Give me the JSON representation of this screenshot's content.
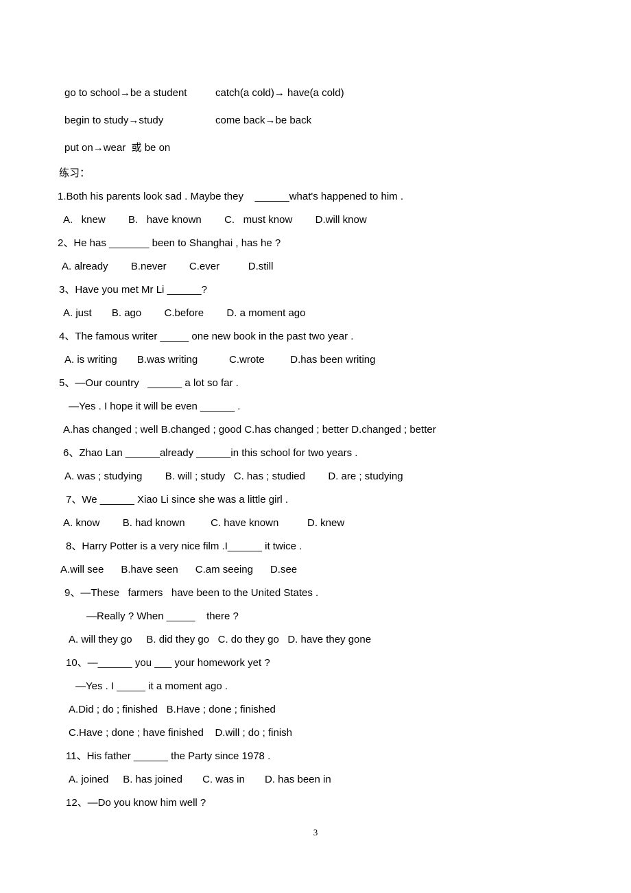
{
  "document": {
    "page_number": "3"
  },
  "vocab_block": {
    "rows": [
      {
        "left": "go to school→be a student",
        "right": "catch(a cold)→ have(a cold)"
      },
      {
        "left": "begin to study→study",
        "right": "come back→be back"
      },
      {
        "left": "put on→wear  或 be on",
        "right": ""
      }
    ]
  },
  "section": {
    "heading": "练习："
  },
  "questions": [
    {
      "id": "q1-stem",
      "indent": 0,
      "text": "1.Both his parents look sad . Maybe they    ______what's happened to him ."
    },
    {
      "id": "q1-options",
      "indent": 4,
      "text": "A.   knew        B.   have known        C.   must know        D.will know"
    },
    {
      "id": "q2-stem",
      "indent": 0,
      "text": "2、He has _______ been to Shanghai , has he ?"
    },
    {
      "id": "q2-options",
      "indent": 3,
      "text": "A. already        B.never        C.ever          D.still"
    },
    {
      "id": "q3-stem",
      "indent": 1,
      "text": "3、Have you met Mr Li ______?"
    },
    {
      "id": "q3-options",
      "indent": 4,
      "text": "A. just       B. ago        C.before        D. a moment ago"
    },
    {
      "id": "q4-stem",
      "indent": 1,
      "text": "4、The famous writer _____ one new book in the past two year ."
    },
    {
      "id": "q4-options",
      "indent": 5,
      "text": "A. is writing       B.was writing           C.wrote         D.has been writing"
    },
    {
      "id": "q5-stem",
      "indent": 1,
      "text": "5、—Our country   ______ a lot so far ."
    },
    {
      "id": "q5-reply",
      "indent": 7,
      "text": "—Yes . I hope it will be even ______ ."
    },
    {
      "id": "q5-options",
      "indent": 4,
      "text": "A.has changed ; well B.changed ; good C.has changed ; better D.changed ; better"
    },
    {
      "id": "q6-stem",
      "indent": 4,
      "text": "6、Zhao Lan ______already ______in this school for two years ."
    },
    {
      "id": "q6-options",
      "indent": 5,
      "text": "A. was ; studying        B. will ; study   C. has ; studied        D. are ; studying"
    },
    {
      "id": "q7-stem",
      "indent": 6,
      "text": "7、We ______ Xiao Li since she was a little girl ."
    },
    {
      "id": "q7-options",
      "indent": 4,
      "text": "A. know        B. had known         C. have known          D. knew"
    },
    {
      "id": "q8-stem",
      "indent": 6,
      "text": "8、Harry Potter is a very nice film .I______ it twice ."
    },
    {
      "id": "q8-options",
      "indent": 2,
      "text": "A.will see      B.have seen      C.am seeing      D.see"
    },
    {
      "id": "q9-stem",
      "indent": 5,
      "text": "9、—These   farmers   have been to the United States ."
    },
    {
      "id": "q9-reply",
      "indent": 11,
      "text": "—Really ? When _____    there ?"
    },
    {
      "id": "q9-options",
      "indent": 7,
      "text": "A. will they go     B. did they go   C. do they go   D. have they gone"
    },
    {
      "id": "q10-stem",
      "indent": 6,
      "text": "10、—______ you ___ your homework yet ?"
    },
    {
      "id": "q10-reply",
      "indent": 9,
      "text": "—Yes . I _____ it a moment ago ."
    },
    {
      "id": "q10-optAB",
      "indent": 7,
      "text": "A.Did ; do ; finished   B.Have ; done ; finished"
    },
    {
      "id": "q10-optCD",
      "indent": 7,
      "text": "C.Have ; done ; have finished    D.will ; do ; finish"
    },
    {
      "id": "q11-stem",
      "indent": 6,
      "text": "11、His father ______ the Party since 1978 ."
    },
    {
      "id": "q11-options",
      "indent": 7,
      "text": "A. joined     B. has joined       C. was in       D. has been in"
    },
    {
      "id": "q12-stem",
      "indent": 6,
      "text": "12、—Do you know him well ?"
    }
  ]
}
